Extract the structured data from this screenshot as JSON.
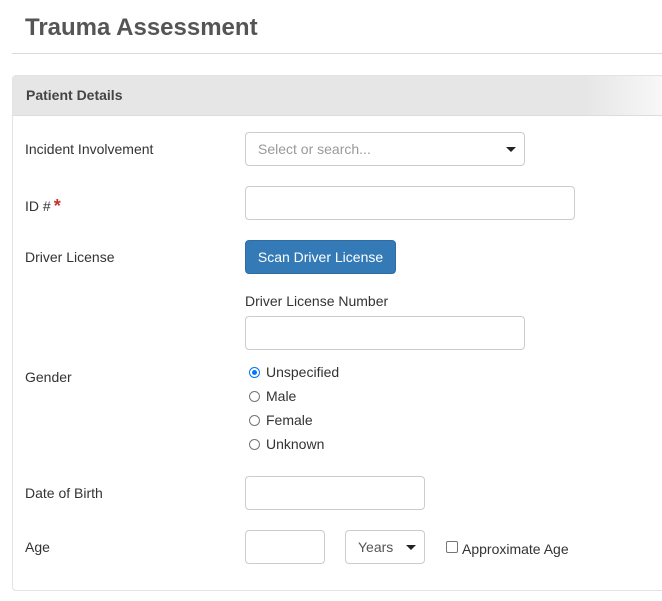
{
  "page": {
    "title": "Trauma Assessment"
  },
  "panel": {
    "header": "Patient Details"
  },
  "fields": {
    "incident": {
      "label": "Incident Involvement",
      "placeholder": "Select or search..."
    },
    "id": {
      "label": "ID #",
      "required_mark": "*",
      "value": ""
    },
    "driver_license": {
      "label": "Driver License",
      "scan_button": "Scan Driver License",
      "number_label": "Driver License Number",
      "number_value": ""
    },
    "gender": {
      "label": "Gender",
      "options": [
        "Unspecified",
        "Male",
        "Female",
        "Unknown"
      ],
      "selected": "Unspecified"
    },
    "dob": {
      "label": "Date of Birth",
      "value": ""
    },
    "age": {
      "label": "Age",
      "value": "",
      "unit": "Years",
      "approximate_label": "Approximate Age",
      "approximate_checked": false
    }
  },
  "colors": {
    "primary": "#337ab7",
    "required": "#c9302c",
    "header_bg": "#e6e6e6"
  },
  "icons": {
    "dropdown": "caret-down-icon"
  }
}
